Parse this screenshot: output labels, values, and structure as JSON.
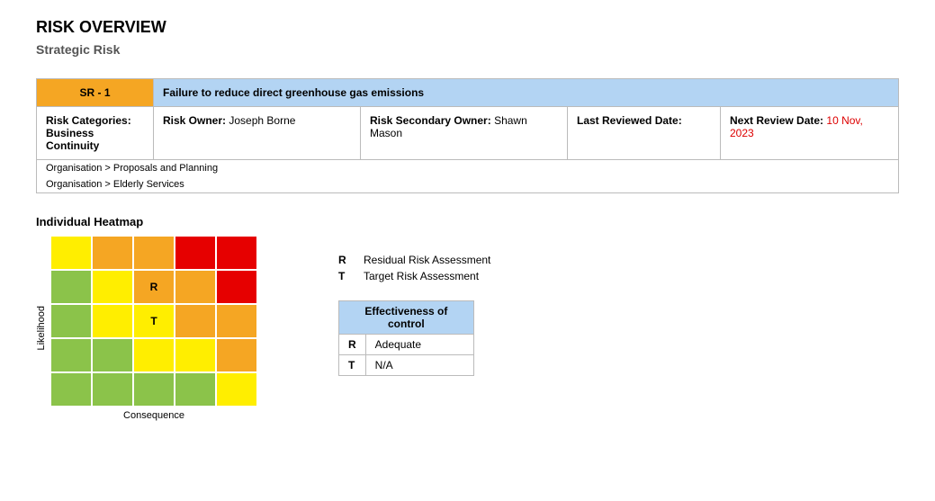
{
  "header": {
    "title": "RISK OVERVIEW",
    "subtitle": "Strategic Risk"
  },
  "risk": {
    "id": "SR - 1",
    "title": "Failure to reduce direct greenhouse gas emissions",
    "categories_label": "Risk Categories:",
    "categories_value": "Business Continuity",
    "owner_label": "Risk Owner:",
    "owner_value": "Joseph Borne",
    "secondary_owner_label": "Risk Secondary Owner:",
    "secondary_owner_value": "Shawn Mason",
    "last_reviewed_label": "Last Reviewed Date:",
    "last_reviewed_value": "",
    "next_review_label": "Next Review Date:",
    "next_review_value": "10 Nov, 2023",
    "org_paths": [
      "Organisation > Proposals and Planning",
      "Organisation > Elderly Services"
    ]
  },
  "heatmap": {
    "section_label": "Individual Heatmap",
    "y_axis": "Likelihood",
    "x_axis": "Consequence",
    "markers": {
      "R": "R",
      "T": "T"
    }
  },
  "legend": {
    "R_key": "R",
    "R_text": "Residual Risk Assessment",
    "T_key": "T",
    "T_text": "Target Risk Assessment"
  },
  "effectiveness": {
    "header": "Effectiveness of control",
    "rows": [
      {
        "key": "R",
        "value": "Adequate"
      },
      {
        "key": "T",
        "value": "N/A"
      }
    ]
  },
  "chart_data": {
    "type": "heatmap",
    "xlabel": "Consequence",
    "ylabel": "Likelihood",
    "x_range": [
      1,
      5
    ],
    "y_range": [
      1,
      5
    ],
    "color_levels": [
      "green",
      "yellow",
      "orange",
      "red"
    ],
    "grid": [
      [
        "yellow",
        "orange",
        "orange",
        "red",
        "red"
      ],
      [
        "green",
        "yellow",
        "orange",
        "orange",
        "red"
      ],
      [
        "green",
        "yellow",
        "yellow",
        "orange",
        "orange"
      ],
      [
        "green",
        "green",
        "yellow",
        "yellow",
        "orange"
      ],
      [
        "green",
        "green",
        "green",
        "green",
        "yellow"
      ]
    ],
    "markers": [
      {
        "label": "R",
        "likelihood": 4,
        "consequence": 3,
        "meaning": "Residual Risk Assessment"
      },
      {
        "label": "T",
        "likelihood": 3,
        "consequence": 3,
        "meaning": "Target Risk Assessment"
      }
    ]
  }
}
